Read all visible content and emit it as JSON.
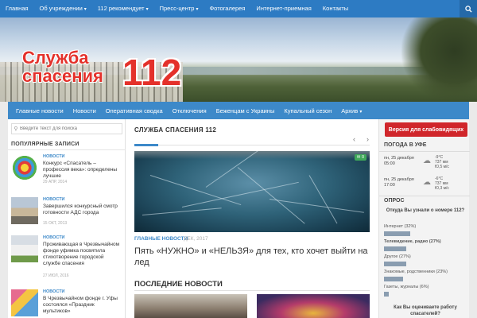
{
  "top_nav": {
    "items": [
      "Главная",
      "Об учреждении",
      "112 рекомендует",
      "Пресс-центр",
      "Фотогалерея",
      "Интернет-приемная",
      "Контакты"
    ],
    "has_caret": [
      false,
      true,
      true,
      true,
      false,
      false,
      false
    ]
  },
  "logo": {
    "line1": "Служба",
    "line2": "спасения",
    "number": "112"
  },
  "sub_nav": {
    "items": [
      "Главные новости",
      "Новости",
      "Оперативная сводка",
      "Отключения",
      "Беженцам с Украины",
      "Купальный сезон",
      "Архив"
    ]
  },
  "search": {
    "placeholder": "Введите текст для поиска"
  },
  "popular": {
    "heading": "ПОПУЛЯРНЫЕ ЗАПИСИ",
    "posts": [
      {
        "category": "НОВОСТИ",
        "title": "Конкурс «Спасатель – профессия века»: определены лучшие",
        "date": "29 АПР, 2014"
      },
      {
        "category": "НОВОСТИ",
        "title": "Завершился конкурсный смотр готовности АДС города",
        "date": "15 ОКТ, 2013"
      },
      {
        "category": "НОВОСТИ",
        "title": "Проживающая в Чрезвычайном фонде уфимка посвятила стихотворение городской службе спасения",
        "date": "27 ИЮЛ, 2016"
      },
      {
        "category": "НОВОСТИ",
        "title": "В Чрезвычайном фонде г. Уфы состоялся «Праздник мультиков»",
        "date": ""
      }
    ]
  },
  "main": {
    "heading": "СЛУЖБА СПАСЕНИЯ 112",
    "prev_arrow": "‹",
    "next_arrow": "›",
    "hero": {
      "comments": "0",
      "category": "ГЛАВНЫЕ НОВОСТИ",
      "date": "ДЕК, 2017",
      "title": "Пять «НУЖНО» и «НЕЛЬЗЯ» для тех, кто хочет выйти на лед"
    },
    "latest_heading": "ПОСЛЕДНИЕ НОВОСТИ"
  },
  "right": {
    "vision_button": "Версия для слабовидящих",
    "weather": {
      "heading": "ПОГОДА В УФЕ",
      "rows": [
        {
          "day": "пн, 25 декабря",
          "time": "05:00",
          "temp": "-9°C",
          "pressure": "737 мм",
          "wind": "Ю,5 м/с"
        },
        {
          "day": "пн, 25 декабря",
          "time": "17:00",
          "temp": "-6°C",
          "pressure": "737 мм",
          "wind": "Ю,3 м/с"
        }
      ]
    },
    "poll": {
      "heading": "ОПРОС",
      "question": "Откуда Вы узнали о номере 112?",
      "options": [
        {
          "label": "Интернет (32%)",
          "percent": 32,
          "bold": false
        },
        {
          "label": "Телевидение, радио (27%)",
          "percent": 27,
          "bold": true
        },
        {
          "label": "Другое (27%)",
          "percent": 27,
          "bold": false
        },
        {
          "label": "Знакомые, родственники (23%)",
          "percent": 23,
          "bold": false
        },
        {
          "label": "Газеты, журналы (6%)",
          "percent": 6,
          "bold": false
        }
      ],
      "question2": "Как Вы оцениваете работу спасателей?"
    }
  },
  "colors": {
    "nav": "#2d7bc3",
    "subnav": "#3d89c9",
    "accent_red": "#d0262b",
    "logo_red": "#e4312b"
  }
}
